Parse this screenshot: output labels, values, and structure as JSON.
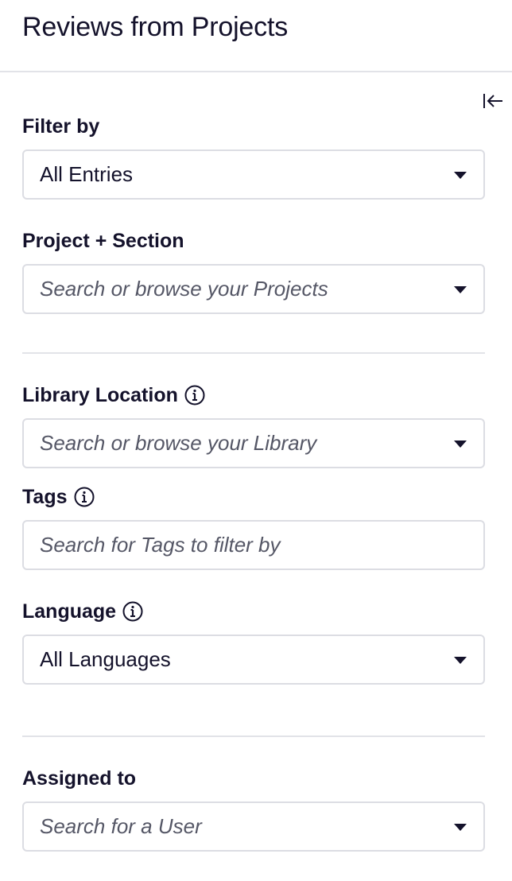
{
  "header": {
    "title": "Reviews from Projects"
  },
  "filter_by": {
    "label": "Filter by",
    "value": "All Entries"
  },
  "project_section": {
    "label": "Project + Section",
    "placeholder": "Search or browse your Projects"
  },
  "library_location": {
    "label": "Library Location",
    "placeholder": "Search or browse your Library"
  },
  "tags": {
    "label": "Tags",
    "placeholder": "Search for Tags to filter by"
  },
  "language": {
    "label": "Language",
    "value": "All Languages"
  },
  "assigned_to": {
    "label": "Assigned to",
    "placeholder": "Search for a User"
  },
  "icons": {
    "collapse": "collapse-left-icon",
    "info": "info-icon",
    "dropdown": "caret-down-icon"
  },
  "colors": {
    "text": "#14122b",
    "placeholder": "#555766",
    "border": "#dcdde3",
    "divider": "#e2e3e8"
  }
}
